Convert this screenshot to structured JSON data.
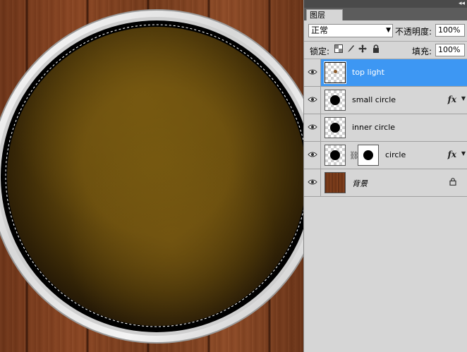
{
  "panel": {
    "collapse_icon": "◂◂",
    "tab_label": "图层",
    "blend_mode": "正常",
    "opacity_label": "不透明度:",
    "opacity_value": "100%",
    "lock_label": "锁定:",
    "fill_label": "填充:",
    "fill_value": "100%",
    "lock_icons": [
      "lock-transparent-pixels-icon",
      "lock-image-pixels-icon",
      "lock-position-icon",
      "lock-all-icon"
    ]
  },
  "layers": [
    {
      "name": "top light",
      "selected": true,
      "fx": false
    },
    {
      "name": "small circle",
      "selected": false,
      "fx": true
    },
    {
      "name": "inner circle",
      "selected": false,
      "fx": false
    },
    {
      "name": "circle",
      "selected": false,
      "fx": true,
      "mask": true
    },
    {
      "name": "背景",
      "selected": false,
      "locked": true
    }
  ],
  "fx_label": "fx",
  "colors": {
    "selection": "#3d97f3",
    "panel_bg": "#d6d6d6",
    "plate_inner": "#6e5210",
    "plate_edge": "#241806",
    "rim": "#f0f0f0",
    "wood": "#7a3d1e"
  }
}
